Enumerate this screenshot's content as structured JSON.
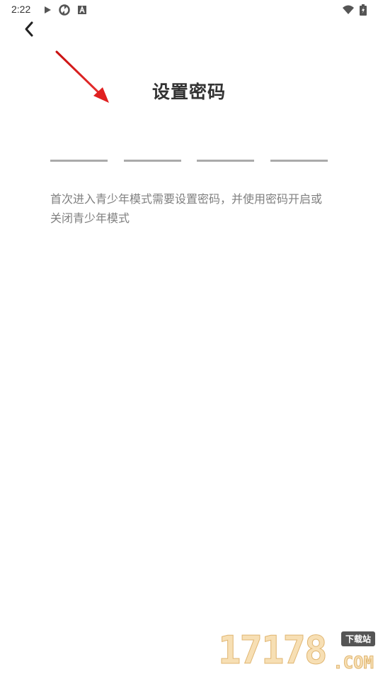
{
  "status_bar": {
    "time": "2:22",
    "icons": [
      "play-icon",
      "sync-icon",
      "a-icon",
      "wifi-icon",
      "battery-charging-icon"
    ]
  },
  "header": {
    "back_icon": "chevron-left-icon"
  },
  "main": {
    "title": "设置密码",
    "pin_length": 4,
    "description": "首次进入青少年模式需要设置密码，并使用密码开启或关闭青少年模式"
  },
  "annotation": {
    "arrow_color": "#e02020"
  },
  "watermark": {
    "digits": "17178",
    "tag": "下载站",
    "com": ".COM"
  },
  "colors": {
    "text_primary": "#333333",
    "text_secondary": "#808080",
    "pin_line": "#aaaaaa",
    "background": "#ffffff"
  }
}
